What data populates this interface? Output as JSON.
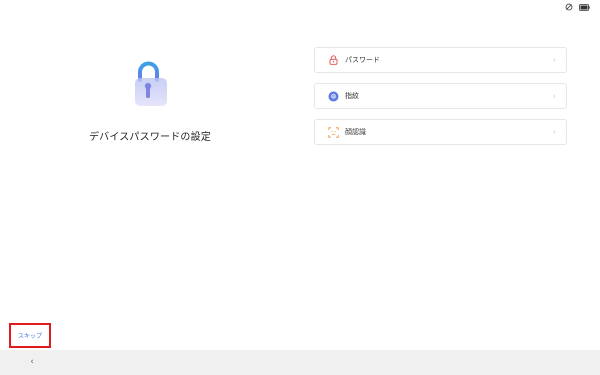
{
  "status_bar": {
    "icons": [
      "rotate-lock-icon",
      "battery-icon"
    ]
  },
  "title": "デバイスパスワードの設定",
  "options": [
    {
      "label": "パスワード",
      "icon": "lock-icon",
      "icon_color": "#e04848"
    },
    {
      "label": "指紋",
      "icon": "fingerprint-icon",
      "icon_color": "#4a6fe0"
    },
    {
      "label": "顔認識",
      "icon": "face-scan-icon",
      "icon_color": "#f08a2a"
    }
  ],
  "chevron": "›",
  "skip_label": "スキップ",
  "nav": {
    "back": "‹"
  },
  "colors": {
    "accent": "#4a78e0",
    "highlight_border": "#e01b1b",
    "nav_background": "#f0f0f0"
  }
}
